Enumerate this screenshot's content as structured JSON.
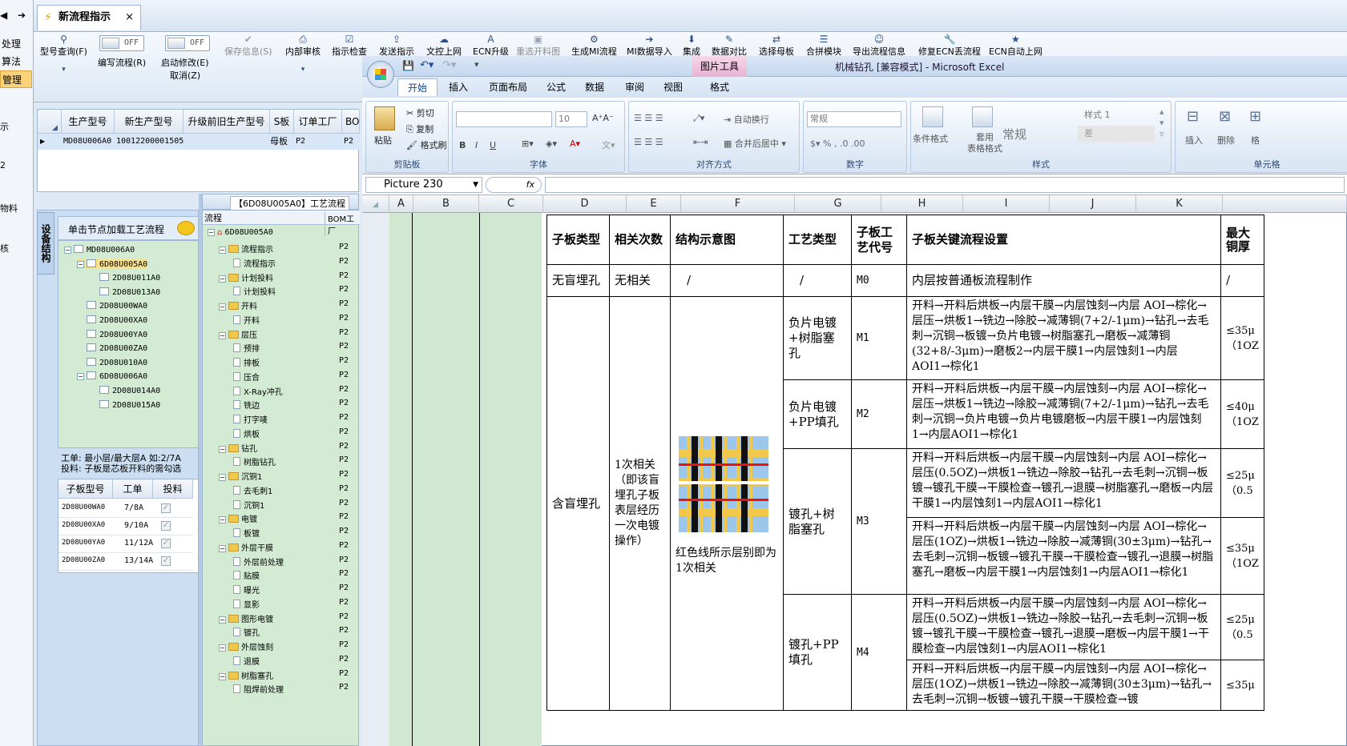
{
  "app": {
    "tab_title": "新流程指示",
    "tab_close": "×"
  },
  "left_strip": {
    "items": [
      "处理",
      "算法",
      "管理"
    ],
    "lines": [
      "示",
      "2",
      "物料",
      "核"
    ]
  },
  "toolbar": {
    "buttons": [
      {
        "label": "型号查询(F)",
        "icon": "search-icon"
      },
      {
        "label": "编写流程(R)",
        "toggle": "OFF"
      },
      {
        "label": "启动修改(E)",
        "toggle": "OFF",
        "sub": "取消(Z)"
      },
      {
        "label": "保存信息(S)",
        "disabled": true
      },
      {
        "label": "内部审核"
      },
      {
        "label": "指示检查"
      },
      {
        "label": "发送指示"
      },
      {
        "label": "文控上网"
      },
      {
        "label": "ECN升级"
      },
      {
        "label": "重选开料图",
        "disabled": true
      },
      {
        "label": "生成MI流程"
      },
      {
        "label": "MI数据导入"
      },
      {
        "label": "集成"
      },
      {
        "label": "数据对比"
      },
      {
        "label": "选择母板"
      },
      {
        "label": "合拼模块"
      },
      {
        "label": "导出流程信息"
      },
      {
        "label": "修复ECN丢流程"
      },
      {
        "label": "ECN自动上网"
      }
    ]
  },
  "order_grid": {
    "headers": [
      "生产型号",
      "新生产型号",
      "升级前旧生产型号",
      "S板",
      "订单工厂",
      "BO"
    ],
    "row": [
      "MD08U006A0",
      "10012200001505",
      "",
      "母板",
      "P2",
      "P2"
    ]
  },
  "device_panel": {
    "tab_label": "设备结构",
    "hint": "单击节点加载工艺流程",
    "tree": [
      "MD08U006A0",
      "6D08U005A0",
      "2D08U011A0",
      "2D08U013A0",
      "2D08U00WA0",
      "2D08U00XA0",
      "2D08U00YA0",
      "2D08U00ZA0",
      "2D08U010A0",
      "6D08U006A0",
      "2D08U014A0",
      "2D08U015A0"
    ],
    "note_line1": "工单: 最小层/最大层A 如:2/7A",
    "note_line2": "投料: 子板是芯板开料的需勾选",
    "sub_headers": [
      "子板型号",
      "工单",
      "投料"
    ],
    "sub_rows": [
      [
        "2D08U00WA0",
        "7/8A"
      ],
      [
        "2D08U00XA0",
        "9/10A"
      ],
      [
        "2D08U00YA0",
        "11/12A"
      ],
      [
        "2D08U00ZA0",
        "13/14A"
      ]
    ]
  },
  "flow_panel": {
    "title": "【6D08U005A0】工艺流程",
    "col_flow": "流程",
    "col_bom": "BOM工厂",
    "root": "6D08U005A0",
    "nodes": [
      {
        "t": "f",
        "label": "流程指示"
      },
      {
        "t": "d",
        "label": "流程指示"
      },
      {
        "t": "f",
        "label": "计划投料"
      },
      {
        "t": "d",
        "label": "计划投料"
      },
      {
        "t": "f",
        "label": "开料"
      },
      {
        "t": "d",
        "label": "开料"
      },
      {
        "t": "f",
        "label": "层压"
      },
      {
        "t": "d",
        "label": "预排"
      },
      {
        "t": "d",
        "label": "排板"
      },
      {
        "t": "d",
        "label": "压合"
      },
      {
        "t": "d",
        "label": "X-Ray冲孔"
      },
      {
        "t": "d",
        "label": "铣边"
      },
      {
        "t": "d",
        "label": "打字唛"
      },
      {
        "t": "d",
        "label": "烘板"
      },
      {
        "t": "f",
        "label": "钻孔"
      },
      {
        "t": "d",
        "label": "树脂钻孔"
      },
      {
        "t": "f",
        "label": "沉铜1"
      },
      {
        "t": "d",
        "label": "去毛刺1"
      },
      {
        "t": "d",
        "label": "沉铜1"
      },
      {
        "t": "f",
        "label": "电镀"
      },
      {
        "t": "d",
        "label": "板镀"
      },
      {
        "t": "f",
        "label": "外层干膜"
      },
      {
        "t": "d",
        "label": "外层前处理"
      },
      {
        "t": "d",
        "label": "贴膜"
      },
      {
        "t": "d",
        "label": "曝光"
      },
      {
        "t": "d",
        "label": "显影"
      },
      {
        "t": "f",
        "label": "图形电镀"
      },
      {
        "t": "d",
        "label": "镀孔"
      },
      {
        "t": "f",
        "label": "外层蚀刻"
      },
      {
        "t": "d",
        "label": "退膜"
      },
      {
        "t": "f",
        "label": "树脂塞孔"
      },
      {
        "t": "d",
        "label": "阻焊前处理"
      }
    ],
    "factory": "P2"
  },
  "excel": {
    "picture_tools": "图片工具",
    "title": "机械钻孔  [兼容模式] - Microsoft Excel",
    "tabs": [
      "开始",
      "插入",
      "页面布局",
      "公式",
      "数据",
      "审阅",
      "视图",
      "格式"
    ],
    "groups": {
      "clipboard": "剪贴板",
      "font": "字体",
      "align": "对齐方式",
      "number": "数字",
      "style": "样式",
      "cells": "单元格"
    },
    "ribbon": {
      "paste": "粘贴",
      "cut": "剪切",
      "copy": "复制",
      "brush": "格式刷",
      "font_size": "10",
      "wrap": "自动换行",
      "merge": "合并后居中",
      "num_fmt": "常规",
      "cond": "条件格式",
      "tbl": "套用\n表格格式",
      "style_normal": "常规",
      "style1": "样式 1",
      "style_bad": "差",
      "insert": "插入",
      "delete": "删除",
      "format": "格"
    },
    "name_box": "Picture 230",
    "fx": "fx",
    "columns": [
      "A",
      "B",
      "C",
      "D",
      "E",
      "F",
      "G",
      "H",
      "I",
      "J",
      "K"
    ]
  },
  "process_table": {
    "headers": [
      "子板类型",
      "相关次数",
      "结构示意图",
      "工艺类型",
      "子板工艺代号",
      "子板关键流程设置",
      "最大\n铜厚"
    ],
    "row0": [
      "无盲埋孔",
      "无相关",
      "/",
      "/",
      "M0",
      "内层按普通板流程制作",
      "/"
    ],
    "group_type": "含盲埋孔",
    "group_rel": "1次相关（即该盲埋孔子板表层经历一次电镀操作）",
    "diagram_caption": "红色线所示层别即为1次相关",
    "rows": [
      {
        "proc": "负片电镀+树脂塞孔",
        "code": "M1",
        "flow": "开料→开料后烘板→内层干膜→内层蚀刻→内层 AOI→棕化→层压→烘板1→铣边→除胶→减薄铜(7+2/-1μm)→钻孔→去毛刺→沉铜→板镀→负片电镀→树脂塞孔→磨板→减薄铜(32+8/-3μm)→磨板2→内层干膜1→内层蚀刻1→内层AOI1→棕化1",
        "max": "≤35μ（1OZ"
      },
      {
        "proc": "负片电镀+PP填孔",
        "code": "M2",
        "flow": "开料→开料后烘板→内层干膜→内层蚀刻→内层 AOI→棕化→层压→烘板1→铣边→除胶→减薄铜(7+2/-1μm)→钻孔→去毛刺→沉铜→负片电镀→负片电镀磨板→内层干膜1→内层蚀刻1→内层AOI1→棕化1",
        "max": "≤40μ（1OZ"
      },
      {
        "proc": "镀孔+树脂塞孔",
        "code": "M3",
        "flow": "开料→开料后烘板→内层干膜→内层蚀刻→内层 AOI→棕化→层压(0.5OZ)→烘板1→铣边→除胶→钻孔→去毛刺→沉铜→板镀→镀孔干膜→干膜检查→镀孔→退膜→树脂塞孔→磨板→内层干膜1→内层蚀刻1→内层AOI1→棕化1",
        "max": "≤25μ（0.5"
      },
      {
        "proc": "",
        "code": "",
        "flow": "开料→开料后烘板→内层干膜→内层蚀刻→内层 AOI→棕化→层压(1OZ)→烘板1→铣边→除胶→减薄铜(30±3μm)→钻孔→去毛刺→沉铜→板镀→镀孔干膜→干膜检查→镀孔→退膜→树脂塞孔→磨板→内层干膜1→内层蚀刻1→内层AOI1→棕化1",
        "max": "≤35μ（1OZ"
      },
      {
        "proc": "镀孔+PP填孔",
        "code": "M4",
        "flow": "开料→开料后烘板→内层干膜→内层蚀刻→内层 AOI→棕化→层压(0.5OZ)→烘板1→铣边→除胶→钻孔→去毛刺→沉铜→板镀→镀孔干膜→干膜检查→镀孔→退膜→磨板→内层干膜1→干膜检查→内层蚀刻1→内层AOI1→棕化1",
        "max": "≤25μ（0.5"
      },
      {
        "proc": "",
        "code": "",
        "flow": "开料→开料后烘板→内层干膜→内层蚀刻→内层 AOI→棕化→层压(1OZ)→烘板1→铣边→除胶→减薄铜(30±3μm)→钻孔→去毛刺→沉铜→板镀→镀孔干膜→干膜检查→镀",
        "max": "≤35μ"
      }
    ]
  }
}
